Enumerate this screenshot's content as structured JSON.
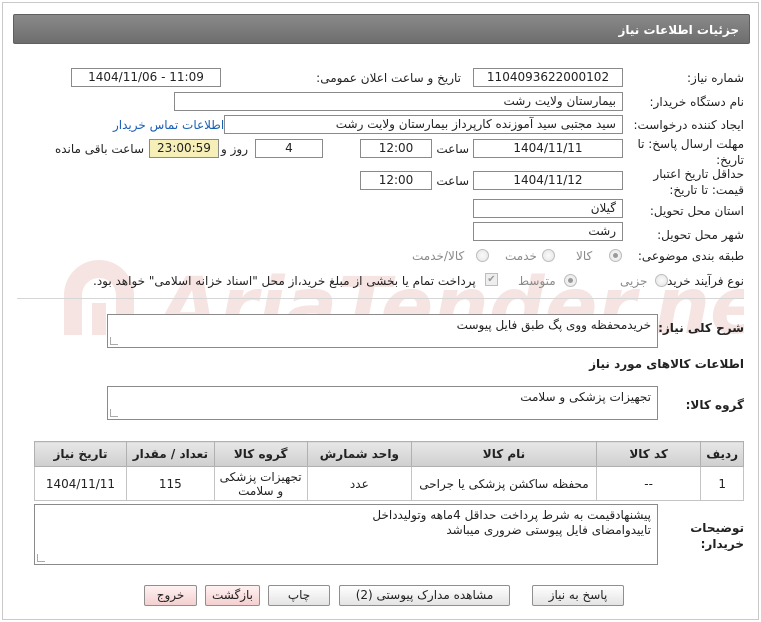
{
  "header": {
    "title": "جزئیات اطلاعات نیاز"
  },
  "form": {
    "need_number_label": "شماره نیاز:",
    "need_number": "1104093622000102",
    "announce_label": "تاریخ و ساعت اعلان عمومی:",
    "announce_value": "1404/11/06 - 11:09",
    "buyer_org_label": "نام دستگاه خریدار:",
    "buyer_org": "بیمارستان ولایت رشت",
    "creator_label": "ایجاد کننده درخواست:",
    "creator": "سید مجتبی سید آموزنده کارپرداز بیمارستان ولایت رشت",
    "contact_link": "اطلاعات تماس خریدار",
    "reply_deadline_label": "مهلت ارسال پاسخ: تا تاریخ:",
    "reply_date": "1404/11/11",
    "time_label": "ساعت",
    "reply_time": "12:00",
    "days_value": "4",
    "days_label": "روز و",
    "remaining_time": "23:00:59",
    "remaining_label": "ساعت باقی مانده",
    "validity_label": "حداقل تاریخ اعتبار قیمت: تا تاریخ:",
    "validity_date": "1404/11/12",
    "validity_time": "12:00",
    "province_label": "استان محل تحویل:",
    "province": "گیلان",
    "city_label": "شهر محل تحویل:",
    "city": "رشت",
    "category_label": "طبقه بندی موضوعی:",
    "category_options": [
      "کالا",
      "خدمت",
      "کالا/خدمت"
    ],
    "category_selected": "کالا",
    "process_label": "نوع فرآیند خرید :",
    "process_options": [
      "جزیی",
      "متوسط"
    ],
    "process_selected": "جزیی",
    "payment_note": "پرداخت تمام یا بخشی از مبلغ خرید،از محل \"اسناد خزانه اسلامی\" خواهد بود.",
    "payment_checked": true
  },
  "description": {
    "label": "شرح کلی نیاز:",
    "value": "خریدمحفظه ووی پگ طبق فایل پیوست"
  },
  "goods_section": {
    "title": "اطلاعات کالاهای مورد نیاز",
    "group_label": "گروه کالا:",
    "group_value": "تجهیزات پزشکی و سلامت"
  },
  "table": {
    "headers": [
      "ردیف",
      "کد کالا",
      "نام کالا",
      "واحد شمارش",
      "گروه کالا",
      "تعداد / مقدار",
      "تاریخ نیاز"
    ],
    "rows": [
      {
        "row": "1",
        "code": "--",
        "name": "محفظه ساکشن پزشکی یا جراحی",
        "unit": "عدد",
        "group": "تجهیزات پزشکی و سلامت",
        "qty": "115",
        "date": "1404/11/11"
      }
    ]
  },
  "buyer_notes": {
    "label": "توضیحات خریدار:",
    "line1": "پیشنهادقیمت به شرط پرداخت حداقل 4ماهه وتولیدداخل",
    "line2": "تاییدوامضای فایل پیوستی ضروری میباشد"
  },
  "buttons": {
    "reply": "پاسخ به نیاز",
    "attachments": "مشاهده مدارک پیوستی (2)",
    "print": "چاپ",
    "back": "بازگشت",
    "exit": "خروج"
  },
  "watermark": {
    "text": "AriaTender.net",
    "color": "#c0392b"
  }
}
